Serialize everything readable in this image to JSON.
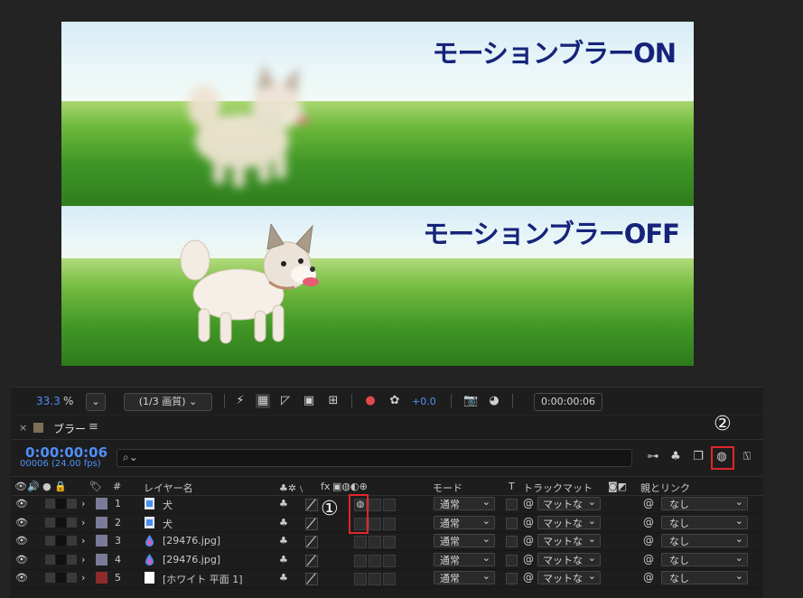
{
  "viewer": {
    "caption_on": "モーションブラーON",
    "caption_off": "モーションブラーOFF"
  },
  "viewer_toolbar": {
    "zoom_value": "33.3",
    "zoom_unit": "%",
    "resolution": "(1/3 画質)",
    "exposure": "+0.0",
    "timecode": "0:00:00:06"
  },
  "timeline": {
    "tab_close": "×",
    "tab_title": "ブラー",
    "tab_color": "#7d6e58",
    "current_time": "0:00:00:06",
    "frame_info": "00006 (24.00 fps)",
    "search_placeholder": "",
    "callout_1": "①",
    "callout_2": "②",
    "columns": {
      "number": "#",
      "layer_name": "レイヤー名",
      "fx": "fx",
      "mode": "モード",
      "t": "T",
      "track_matte": "トラックマット",
      "parent": "親とリンク"
    },
    "layers": [
      {
        "num": "1",
        "name": "犬",
        "label_color": "#7a7a99",
        "source": "image",
        "motion_blur": true,
        "mode": "通常",
        "matte": "マットな",
        "parent": "なし"
      },
      {
        "num": "2",
        "name": "犬",
        "label_color": "#7a7a99",
        "source": "image",
        "motion_blur": false,
        "mode": "通常",
        "matte": "マットな",
        "parent": "なし"
      },
      {
        "num": "3",
        "name": "[29476.jpg]",
        "label_color": "#7a7a99",
        "source": "drop",
        "motion_blur": false,
        "mode": "通常",
        "matte": "マットな",
        "parent": "なし"
      },
      {
        "num": "4",
        "name": "[29476.jpg]",
        "label_color": "#7a7a99",
        "source": "drop",
        "motion_blur": false,
        "mode": "通常",
        "matte": "マットな",
        "parent": "なし"
      },
      {
        "num": "5",
        "name": "[ホワイト 平面 1]",
        "label_color": "#8f2a2a",
        "source": "solid",
        "motion_blur": false,
        "mode": "通常",
        "matte": "マットな",
        "parent": "なし"
      }
    ]
  },
  "colors": {
    "accent_blue": "#4f8ff7",
    "highlight_red": "#e0262a",
    "caption_navy": "#16237a"
  }
}
